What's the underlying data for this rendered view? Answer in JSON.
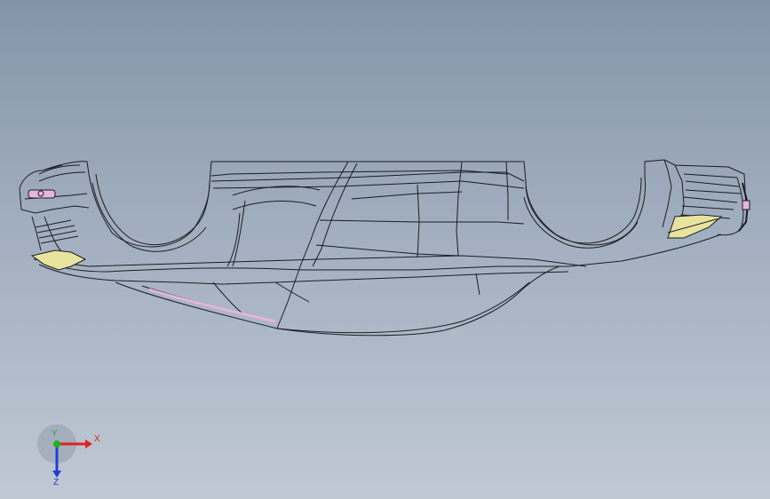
{
  "viewport": {
    "background_top": "#8494a8",
    "background_bottom": "#c0c8d4"
  },
  "model": {
    "edge_color": "#1a1d22",
    "highlight_yellow": "#e8e4a0",
    "highlight_pink": "#e6b4dc"
  },
  "triad": {
    "x_label": "X",
    "y_label": "Y",
    "z_label": "Z",
    "x_color": "#e02020",
    "y_color": "#20b020",
    "z_color": "#2040d0"
  }
}
